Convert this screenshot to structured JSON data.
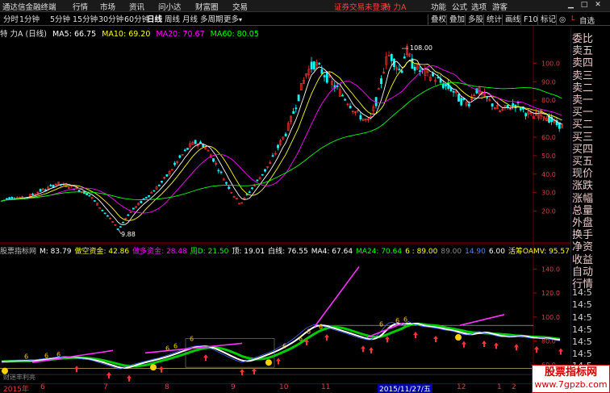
{
  "topbar": {
    "logo": "通达信金融终端",
    "menus": [
      "行情",
      "市场",
      "资讯",
      "问小达",
      "财富圈",
      "交易"
    ],
    "notice": "证券交易未登录",
    "stock": "特 力A",
    "right": [
      "功能",
      "公式",
      "选项",
      "游客"
    ]
  },
  "periods": [
    "分时",
    "1分钟",
    "5分钟",
    "15分钟",
    "30分钟",
    "60分钟",
    "日线",
    "周线",
    "月线",
    "多周期",
    "更多"
  ],
  "period_active": "日线",
  "right_tools": [
    "叠权",
    "叠加",
    "多股",
    "统计",
    "画线",
    "F10",
    "标记",
    "◎"
  ],
  "ma_legend": {
    "title": "特 力A (日线)",
    "ma5": "MA5: 66.75",
    "ma10": "MA10: 69.20",
    "ma20": "MA20: 70.67",
    "ma60": "MA60: 80.05",
    "colors": {
      "title": "#e0e0e0",
      "ma5": "#ffffff",
      "ma10": "#ffff00",
      "ma20": "#ff00ff",
      "ma60": "#00ff00"
    }
  },
  "annotations": {
    "high": "108.00",
    "low": "9.88"
  },
  "price_axis": [
    "100.0",
    "90.0",
    "80.0",
    "70.0",
    "60.0",
    "50.0",
    "40.0",
    "30.0",
    "20.0"
  ],
  "indicator_legend": [
    {
      "t": "股票指标网",
      "c": "#c0c0c0"
    },
    {
      "t": "M: 83.79",
      "c": "#ffffff"
    },
    {
      "t": "做空资金: 42.86",
      "c": "#ffff00"
    },
    {
      "t": "做多资金: 28.48",
      "c": "#ff00ff"
    },
    {
      "t": "周D: 21.50",
      "c": "#00ff00"
    },
    {
      "t": "顶: 19.01",
      "c": "#ffffff"
    },
    {
      "t": "白线: 76.55",
      "c": "#ffffff"
    },
    {
      "t": "MA4: 67.64",
      "c": "#ffffff"
    },
    {
      "t": "MA24: 70.64",
      "c": "#00ff00"
    },
    {
      "t": "6 : 89.00",
      "c": "#ffff00"
    },
    {
      "t": "89.00",
      "c": "#888888"
    },
    {
      "t": "14.90",
      "c": "#4488ff"
    },
    {
      "t": "6.00",
      "c": "#ffffff"
    },
    {
      "t": "活筹OAMV: 95.57",
      "c": "#ffff00"
    },
    {
      "t": "势能: 0.00",
      "c": "#ff00ff"
    }
  ],
  "ind_axis": [
    "140.0",
    "120.0",
    "100.0",
    "80.0",
    "60.0"
  ],
  "right_panel": [
    "委比",
    "卖五",
    "卖四",
    "卖三",
    "卖二",
    "卖一",
    "买一",
    "买二",
    "买三",
    "买四",
    "买五",
    "现价",
    "涨跌",
    "涨幅",
    "总量",
    "外盘",
    "换手",
    "净资",
    "收益",
    "自动",
    "行情",
    "14:5",
    "14:5",
    "14:5",
    "14:5",
    "14:5",
    "14:5",
    "14:5",
    "14:5"
  ],
  "right_top": [
    "L",
    "自选"
  ],
  "dates": [
    "2015年",
    "6",
    "7",
    "8",
    "9",
    "10",
    "11",
    "2015/11/27/五",
    "12",
    "1",
    "2"
  ],
  "bottom_left_text": "财迷丰利亮",
  "watermark": {
    "title": "股票指标网",
    "url": "www.7gpzb.com"
  },
  "chart_data": [
    {
      "type": "candlestick",
      "title": "特 力A (日线)",
      "ylim": [
        9.88,
        108.0
      ],
      "series": [
        {
          "name": "MA5",
          "value": 66.75
        },
        {
          "name": "MA10",
          "value": 69.2
        },
        {
          "name": "MA20",
          "value": 70.67
        },
        {
          "name": "MA60",
          "value": 80.05
        }
      ],
      "points": [
        [
          0,
          25.1
        ],
        [
          10,
          27
        ],
        [
          20,
          27.5
        ],
        [
          30,
          27
        ],
        [
          40,
          29
        ],
        [
          50,
          31
        ],
        [
          60,
          32.5
        ],
        [
          70,
          35
        ],
        [
          80,
          34
        ],
        [
          90,
          33
        ],
        [
          100,
          31
        ],
        [
          110,
          29
        ],
        [
          120,
          24
        ],
        [
          130,
          19
        ],
        [
          140,
          14
        ],
        [
          147,
          9.88
        ],
        [
          155,
          16
        ],
        [
          165,
          21
        ],
        [
          175,
          25
        ],
        [
          185,
          29
        ],
        [
          195,
          33
        ],
        [
          205,
          38
        ],
        [
          215,
          44
        ],
        [
          225,
          50
        ],
        [
          235,
          55
        ],
        [
          242,
          57
        ],
        [
          252,
          56
        ],
        [
          262,
          50
        ],
        [
          272,
          42
        ],
        [
          282,
          34
        ],
        [
          292,
          27
        ],
        [
          298,
          24
        ],
        [
          305,
          28
        ],
        [
          315,
          34
        ],
        [
          325,
          40
        ],
        [
          335,
          46
        ],
        [
          345,
          55
        ],
        [
          355,
          63
        ],
        [
          365,
          75
        ],
        [
          372,
          85
        ],
        [
          380,
          95
        ],
        [
          390,
          100
        ],
        [
          400,
          95
        ],
        [
          410,
          90
        ],
        [
          420,
          85
        ],
        [
          430,
          80
        ],
        [
          440,
          74
        ],
        [
          450,
          70
        ],
        [
          458,
          68
        ],
        [
          463,
          75
        ],
        [
          470,
          85
        ],
        [
          477,
          100
        ],
        [
          483,
          105
        ],
        [
          490,
          100
        ],
        [
          497,
          95
        ],
        [
          503,
          108
        ],
        [
          510,
          100
        ],
        [
          520,
          96
        ],
        [
          530,
          94
        ],
        [
          540,
          92
        ],
        [
          550,
          88
        ],
        [
          560,
          86
        ],
        [
          570,
          80
        ],
        [
          580,
          78
        ],
        [
          590,
          86
        ],
        [
          600,
          82
        ],
        [
          610,
          78
        ],
        [
          620,
          74
        ],
        [
          630,
          76
        ],
        [
          640,
          78
        ],
        [
          650,
          74
        ],
        [
          660,
          71
        ],
        [
          670,
          73
        ],
        [
          680,
          70
        ],
        [
          690,
          67
        ],
        [
          697,
          66
        ]
      ]
    },
    {
      "type": "line",
      "title": "股票指标网",
      "ylim": [
        50,
        145
      ],
      "series": [
        {
          "name": "白线",
          "value": 76.55
        },
        {
          "name": "MA4",
          "value": 67.64
        },
        {
          "name": "MA24",
          "value": 70.64
        },
        {
          "name": "活筹OAMV",
          "value": 95.57
        }
      ]
    }
  ]
}
